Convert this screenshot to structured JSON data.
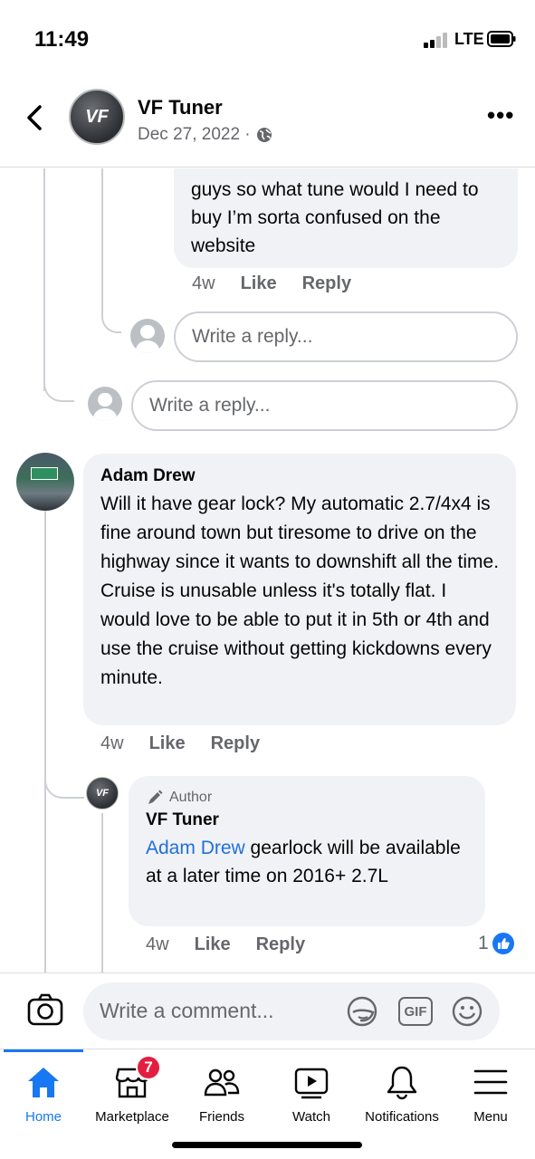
{
  "status": {
    "time": "11:49",
    "network": "LTE"
  },
  "header": {
    "page_name": "VF Tuner",
    "avatar_text": "VF",
    "date": "Dec 27, 2022 ·"
  },
  "thread": {
    "prev_reply": {
      "text": "guys so what tune would I need to buy I’m sorta confused on the website",
      "age": "4w",
      "like": "Like",
      "reply": "Reply"
    },
    "reply_placeholder_nested": "Write a reply...",
    "reply_placeholder": "Write a reply..."
  },
  "comment": {
    "author": "Adam Drew",
    "text": "Will it have gear lock?  My automatic 2.7/4x4 is fine around town but tiresome to drive on the highway since it wants to downshift all the time.  Cruise is unusable unless it's totally flat.  I would love to be able to put it in 5th or 4th and use the cruise without getting kickdowns every minute.",
    "age": "4w",
    "like": "Like",
    "reply": "Reply"
  },
  "author_reply": {
    "badge": "Author",
    "name": "VF Tuner",
    "mention": "Adam Drew",
    "text": " gearlock will be available at a later time on 2016+ 2.7L",
    "age": "4w",
    "like": "Like",
    "reply": "Reply",
    "like_count": "1"
  },
  "composer": {
    "placeholder": "Write a comment...",
    "gif_label": "GIF"
  },
  "tabs": [
    {
      "label": "Home",
      "icon": "home-icon",
      "active": true
    },
    {
      "label": "Marketplace",
      "icon": "marketplace-icon",
      "badge": "7"
    },
    {
      "label": "Friends",
      "icon": "friends-icon"
    },
    {
      "label": "Watch",
      "icon": "watch-icon"
    },
    {
      "label": "Notifications",
      "icon": "bell-icon"
    },
    {
      "label": "Menu",
      "icon": "menu-icon"
    }
  ],
  "colors": {
    "accent": "#1877f2",
    "badge": "#e41e3f",
    "link": "#216fdb"
  }
}
